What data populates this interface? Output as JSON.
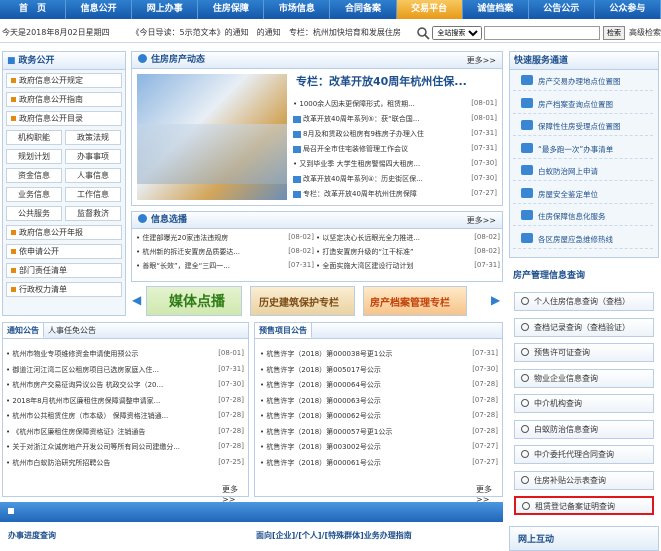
{
  "nav": {
    "items": [
      "首　页",
      "信息公开",
      "网上办事",
      "住房保障",
      "市场信息",
      "合同备案",
      "交易平台",
      "诚信档案",
      "公告公示",
      "公众参与"
    ],
    "active_index": 6
  },
  "infobar": {
    "date": "今天是2018年8月02日星期四",
    "notice": "《今日导读：5示范文本》的通知　的通知",
    "headline": "专栏：杭州加快培育和发展住房",
    "search_scope": "全站搜索",
    "search_value": "",
    "search_button": "检索",
    "advanced": "高级检索"
  },
  "left": {
    "title": "政务公开",
    "items": [
      {
        "label": "政府信息公开规定",
        "wide": true
      },
      {
        "label": "政府信息公开指南",
        "wide": true
      },
      {
        "label": "政府信息公开目录",
        "wide": true
      },
      {
        "label": "机构职能",
        "wide": false
      },
      {
        "label": "政策法规",
        "wide": false
      },
      {
        "label": "规划计划",
        "wide": false
      },
      {
        "label": "办事事项",
        "wide": false
      },
      {
        "label": "资金信息",
        "wide": false
      },
      {
        "label": "人事信息",
        "wide": false
      },
      {
        "label": "业务信息",
        "wide": false
      },
      {
        "label": "工作信息",
        "wide": false
      },
      {
        "label": "公共服务",
        "wide": false
      },
      {
        "label": "监督救济",
        "wide": false
      },
      {
        "label": "政府信息公开年报",
        "wide": true
      },
      {
        "label": "依申请公开",
        "wide": true
      },
      {
        "label": "部门责任清单",
        "wide": true
      },
      {
        "label": "行政权力清单",
        "wide": true
      }
    ]
  },
  "news": {
    "title": "住房房产动态",
    "more": "更多>>",
    "featured": "专栏：改革开放40周年杭州住保...",
    "items": [
      {
        "title": "1000余人因未更保障形式，租赁期...",
        "date": "[08-01]",
        "pic": false
      },
      {
        "title": "改革开放40周年系列⑤：获“联合国...",
        "date": "[08-01]",
        "pic": true
      },
      {
        "title": "8月及和赁政公租房有9栋房子办理入住",
        "date": "[07-31]",
        "pic": true
      },
      {
        "title": "局召开全市住宅装修管理工作会议",
        "date": "[07-31]",
        "pic": true
      },
      {
        "title": "又到毕业季 大学生租房警惕四大租房...",
        "date": "[07-30]",
        "pic": false
      },
      {
        "title": "改革开放40周年系列④：历史街区保...",
        "date": "[07-30]",
        "pic": true
      },
      {
        "title": "专栏：改革开放40周年杭州住房保障",
        "date": "[07-27]",
        "pic": true
      }
    ]
  },
  "policy": {
    "title": "信息选播",
    "more": "更多>>",
    "items": [
      {
        "title": "住建部曝光20家违法违规房",
        "date": "[08-02]"
      },
      {
        "title": "以坚定决心长远眼光全力推进...",
        "date": "[08-02]"
      },
      {
        "title": "杭州新的拆迁安置房品质要达...",
        "date": "[08-02]"
      },
      {
        "title": "打造安置房升级的“江干标准”",
        "date": "[08-02]"
      },
      {
        "title": "善眼“长效”，建全“三四一...",
        "date": "[07-31]"
      },
      {
        "title": "全面实施大湾区建设行动计划",
        "date": "[07-31]"
      }
    ]
  },
  "banners": {
    "b1": "媒体点播",
    "b2": "历史建筑保护专栏",
    "b3": "房产档案管理专栏"
  },
  "notices": {
    "tabs": [
      "通知公告",
      "人事任免公告"
    ],
    "more": "更多>>",
    "items": [
      {
        "title": "杭州市物业专项维修资金申请使用预公示",
        "date": "[08-01]"
      },
      {
        "title": "御道江河江湾二区公租房项目已选房家庭入住...",
        "date": "[07-31]"
      },
      {
        "title": "杭州市房产交易征询异议公告 杭政交公字（20...",
        "date": "[07-30]"
      },
      {
        "title": "2018年8月杭州市区廉租住房保障调整申请家...",
        "date": "[07-28]"
      },
      {
        "title": "杭州市公共租赁住房（市本级） 保障资格注销通...",
        "date": "[07-28]"
      },
      {
        "title": "《杭州市区廉租住房保障资格证》注销通告",
        "date": "[07-28]"
      },
      {
        "title": "关于对浙江众诚房地产开发公司等所有同公司建缴分...",
        "date": "[07-28]"
      },
      {
        "title": "杭州市白蚁防治研究所招聘公告",
        "date": "[07-25]"
      }
    ]
  },
  "presale": {
    "tab": "预售项目公告",
    "more": "更多>>",
    "items": [
      {
        "title": "杭售许字（2018）第000038号更1公示",
        "date": "[07-31]"
      },
      {
        "title": "杭售许字（2018）第005017号公示",
        "date": "[07-30]"
      },
      {
        "title": "杭售许字（2018）第000064号公示",
        "date": "[07-28]"
      },
      {
        "title": "杭售许字（2018）第000063号公示",
        "date": "[07-28]"
      },
      {
        "title": "杭售许字（2018）第000062号公示",
        "date": "[07-28]"
      },
      {
        "title": "杭售许字（2018）第000057号更1公示",
        "date": "[07-28]"
      },
      {
        "title": "杭售许字（2018）第003002号公示",
        "date": "[07-27]"
      },
      {
        "title": "杭售许字（2018）第000061号公示",
        "date": "[07-27]"
      }
    ]
  },
  "bottom": {
    "left_title": "办事进度查询",
    "mid_title": "面向[企业]/[个人]/[特殊群体]业务办理指南"
  },
  "services": {
    "title": "快速服务通道",
    "items": [
      "房产交易办理地点位置图",
      "房产档案查询点位置图",
      "保障性住房受理点位置图",
      "“最多跑一次”办事清单",
      "白蚁防治网上申请",
      "房屋安全鉴定单位",
      "住房保障信息化服务",
      "各区房屋应急维修热线"
    ]
  },
  "query": {
    "title": "房产管理信息查询",
    "items": [
      "个人住房信息查询（查档）",
      "查档记录查询（查档验证）",
      "预售许可证查询",
      "物业企业信息查询",
      "中介机构查询",
      "白蚁防治信息查询",
      "中介委托代理合同查询",
      "住房补贴公示表查询",
      "租赁登记备案证明查询"
    ],
    "highlight_index": 8
  },
  "online": {
    "title": "网上互动"
  }
}
